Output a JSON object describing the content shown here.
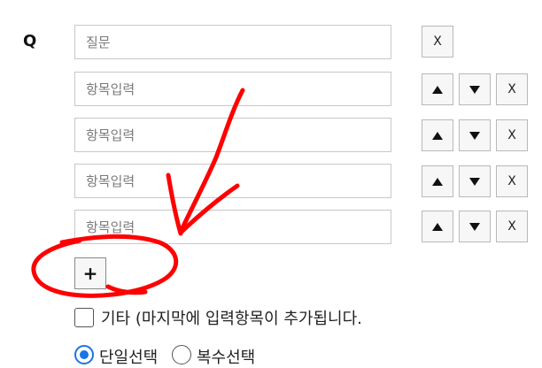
{
  "question": {
    "label": "Q",
    "placeholder": "질문",
    "delete_label": "X"
  },
  "items": [
    {
      "placeholder": "항목입력",
      "delete_label": "X"
    },
    {
      "placeholder": "항목입력",
      "delete_label": "X"
    },
    {
      "placeholder": "항목입력",
      "delete_label": "X"
    },
    {
      "placeholder": "항목입력",
      "delete_label": "X"
    }
  ],
  "add_button": {
    "label": "+"
  },
  "other_option": {
    "label": "기타 (마지막에 입력항목이 추가됩니다."
  },
  "selection": {
    "single": "단일선택",
    "multiple": "복수선택",
    "selected": "single"
  },
  "colors": {
    "annotation": "#ff0000",
    "radio_accent": "#1a73e8"
  }
}
